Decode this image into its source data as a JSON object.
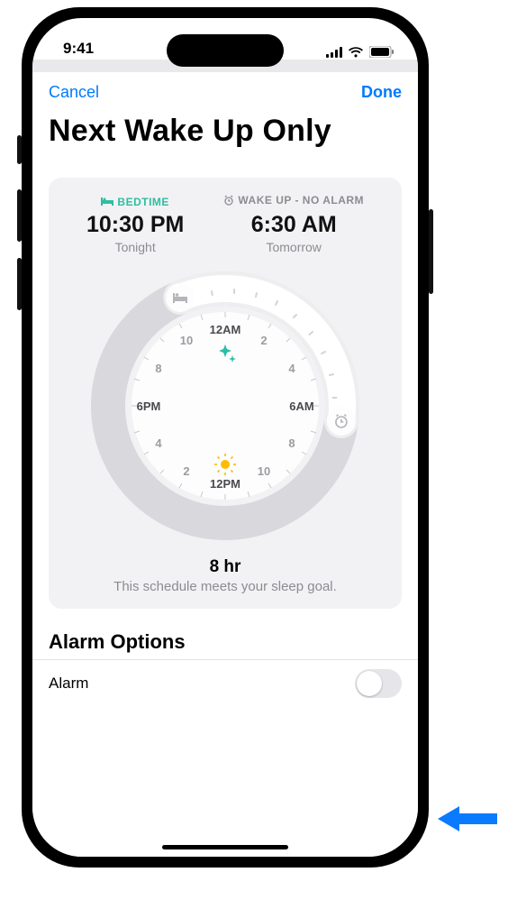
{
  "status": {
    "time": "9:41"
  },
  "nav": {
    "cancel": "Cancel",
    "done": "Done"
  },
  "title": "Next Wake Up Only",
  "bedtime": {
    "label": "BEDTIME",
    "time": "10:30 PM",
    "day": "Tonight"
  },
  "wake": {
    "label": "WAKE UP - NO ALARM",
    "time": "6:30 AM",
    "day": "Tomorrow"
  },
  "dial": {
    "labels": {
      "t12am": "12AM",
      "t2": "2",
      "t4": "4",
      "t6am": "6AM",
      "t8": "8",
      "t10": "10",
      "t12pm": "12PM",
      "t2p": "2",
      "t4p": "4",
      "t6pm": "6PM",
      "t8p": "8",
      "t10p": "10"
    }
  },
  "duration": {
    "hours": "8 hr",
    "goal_text": "This schedule meets your sleep goal."
  },
  "alarm_options": {
    "title": "Alarm Options",
    "alarm_label": "Alarm",
    "alarm_on": false
  }
}
